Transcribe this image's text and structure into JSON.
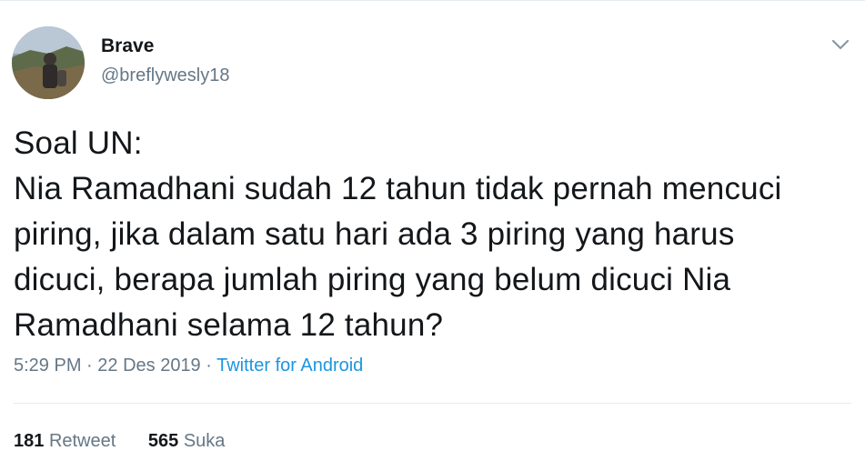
{
  "author": {
    "display_name": "Brave",
    "handle": "@breflywesly18",
    "avatar_icon": "profile-photo"
  },
  "tweet": {
    "lines": [
      "Soal UN:",
      "Nia Ramadhani sudah 12 tahun tidak pernah mencuci",
      "piring, jika dalam satu hari ada 3 piring yang harus",
      "dicuci, berapa jumlah piring yang belum dicuci Nia",
      "Ramadhani selama 12 tahun?"
    ]
  },
  "meta": {
    "time": "5:29 PM",
    "separator1": " · ",
    "date": "22 Des 2019",
    "separator2": " · ",
    "source": "Twitter for Android"
  },
  "stats": {
    "retweet_count": "181",
    "retweet_label": "Retweet",
    "like_count": "565",
    "like_label": "Suka"
  },
  "colors": {
    "text": "#14171a",
    "secondary": "#657786",
    "link": "#1b95e0",
    "divider": "#e6ecf0"
  }
}
